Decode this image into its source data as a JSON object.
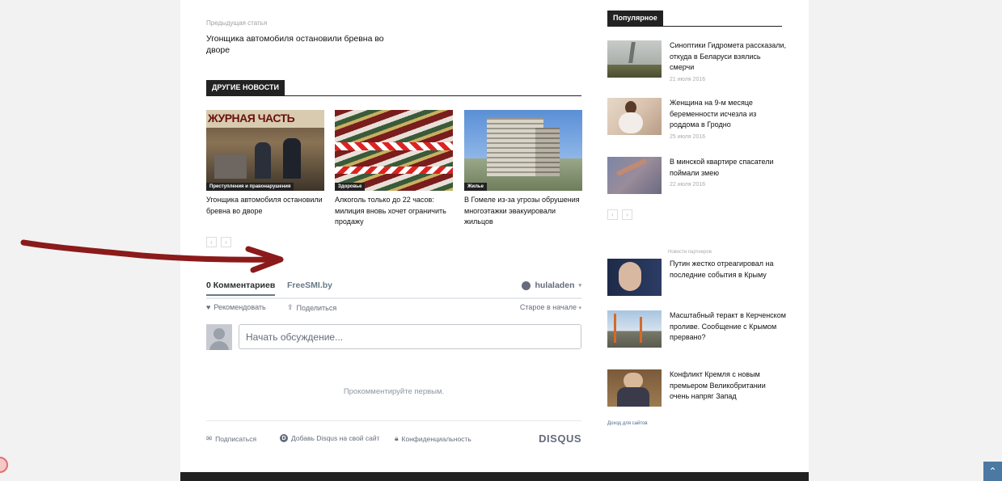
{
  "prev_article": {
    "label": "Предыдущая статья",
    "title": "Угонщика автомобиля остановили бревна во дворе"
  },
  "other_news": {
    "header": "ДРУГИЕ НОВОСТИ",
    "items": [
      {
        "tag": "Преступления и правонарушения",
        "title": "Угонщика автомобиля остановили бревна во дворе",
        "thumb_caption": "ЖУРНАЯ ЧАСТЬ"
      },
      {
        "tag": "Здоровье",
        "title": "Алкоголь только до 22 часов: милиция вновь хочет ограничить продажу"
      },
      {
        "tag": "Жилье",
        "title": "В Гомеле из-за угрозы обрушения многоэтажки эвакуировали жильцов"
      }
    ],
    "pager": {
      "prev": "‹",
      "next": "›"
    }
  },
  "disqus": {
    "comments_tab": "0 Комментариев",
    "site_tab": "FreeSMI.by",
    "user": "hulaladen",
    "recommend": "Рекомендовать",
    "share": "Поделиться",
    "sort": "Старое в начале",
    "input_placeholder": "Начать обсуждение...",
    "empty_message": "Прокомментируйте первым.",
    "subscribe": "Подписаться",
    "add_disqus": "Добавь Disqus на свой сайт",
    "privacy": "Конфиденциальность",
    "logo": "DISQUS"
  },
  "sidebar": {
    "header": "Популярное",
    "popular": [
      {
        "title": "Синоптики Гидромета рассказали, откуда в Беларуси взялись смерчи",
        "date": "21 июля 2016"
      },
      {
        "title": "Женщина на 9-м месяце беременности исчезла из роддома в Гродно",
        "date": "25 июля 2016"
      },
      {
        "title": "В минской квартире спасатели поймали змею",
        "date": "22 июля 2016"
      }
    ],
    "pager": {
      "prev": "‹",
      "next": "›"
    },
    "partner_label": "Новости партнеров",
    "partners": [
      {
        "title": "Путин жестко отреагировал на последние события в Крыму"
      },
      {
        "title": "Масштабный теракт в Керченском проливе. Сообщение с Крымом прервано?"
      },
      {
        "title": "Конфликт Кремля с новым премьером Великобритании очень напряг Запад"
      }
    ],
    "income_link": "Доход для сайтов"
  },
  "scroll_top_icon": "chevron-up-icon",
  "colors": {
    "accent": "#222222",
    "annotation_arrow": "#8b1a1a",
    "disqus_text": "#656c7a"
  }
}
